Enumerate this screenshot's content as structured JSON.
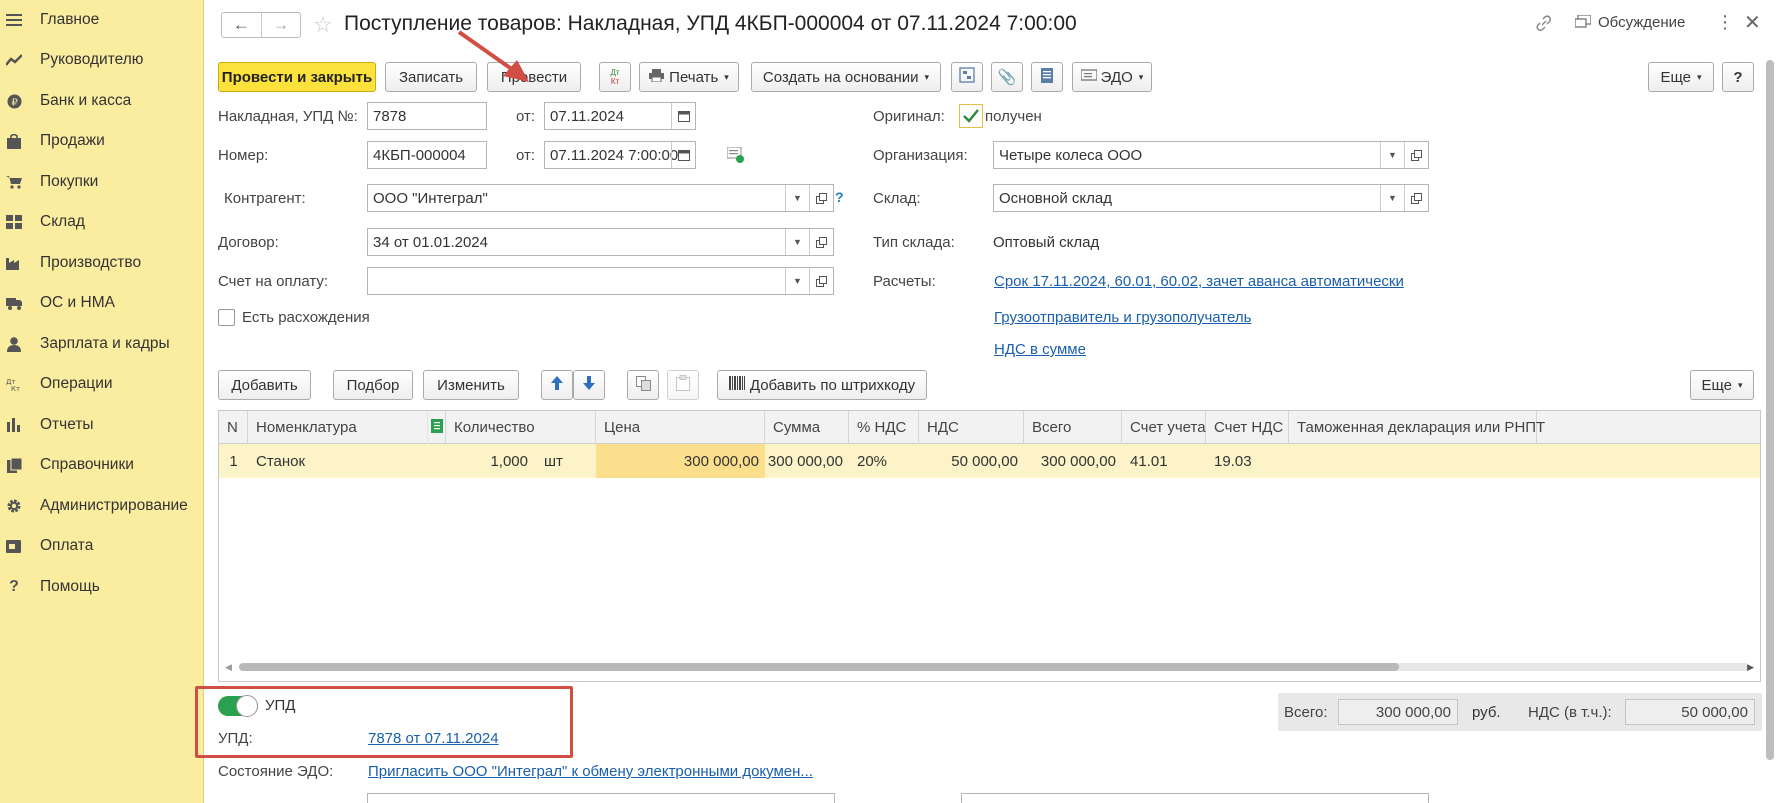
{
  "sidebar": {
    "items": [
      {
        "label": "Главное",
        "icon": "menu-icon"
      },
      {
        "label": "Руководителю",
        "icon": "trend-icon"
      },
      {
        "label": "Банк и касса",
        "icon": "coin-icon"
      },
      {
        "label": "Продажи",
        "icon": "bag-icon"
      },
      {
        "label": "Покупки",
        "icon": "cart-icon"
      },
      {
        "label": "Склад",
        "icon": "warehouse-icon"
      },
      {
        "label": "Производство",
        "icon": "factory-icon"
      },
      {
        "label": "ОС и НМА",
        "icon": "truck-icon"
      },
      {
        "label": "Зарплата и кадры",
        "icon": "person-icon"
      },
      {
        "label": "Операции",
        "icon": "dt-kt-icon"
      },
      {
        "label": "Отчеты",
        "icon": "bar-chart-icon"
      },
      {
        "label": "Справочники",
        "icon": "books-icon"
      },
      {
        "label": "Администрирование",
        "icon": "gear-icon"
      },
      {
        "label": "Оплата",
        "icon": "wallet-icon"
      },
      {
        "label": "Помощь",
        "icon": "help-icon"
      }
    ]
  },
  "header": {
    "title": "Поступление товаров: Накладная, УПД 4КБП-000004 от 07.11.2024 7:00:00",
    "discussion": "Обсуждение"
  },
  "toolbar": {
    "post_close": "Провести и закрыть",
    "save": "Записать",
    "post": "Провести",
    "print": "Печать",
    "create_based": "Создать на основании",
    "edo": "ЭДО",
    "more": "Еще",
    "help": "?",
    "dtkt_top": "Дт",
    "dtkt_bottom": "Кт"
  },
  "form": {
    "invoice_label": "Накладная, УПД №:",
    "invoice_no": "7878",
    "from_label": "от:",
    "invoice_date": "07.11.2024",
    "number_label": "Номер:",
    "number": "4КБП-000004",
    "number_datetime": "07.11.2024  7:00:00",
    "contractor_label": "Контрагент:",
    "contractor": "ООО \"Интеграл\"",
    "contract_label": "Договор:",
    "contract": "34 от 01.01.2024",
    "payment_label": "Счет на оплату:",
    "payment": "",
    "discrepancy_label": "Есть расхождения",
    "original_label": "Оригинал:",
    "original_value": "получен",
    "org_label": "Организация:",
    "org": "Четыре колеса ООО",
    "warehouse_label": "Склад:",
    "warehouse": "Основной склад",
    "wtype_label": "Тип склада:",
    "wtype": "Оптовый склад",
    "calc_label": "Расчеты:",
    "calc_link": "Срок 17.11.2024, 60.01, 60.02, зачет аванса автоматически",
    "shipper_link": "Грузоотправитель и грузополучатель",
    "vat_link": "НДС в сумме",
    "question": "?"
  },
  "table_toolbar": {
    "add": "Добавить",
    "pick": "Подбор",
    "edit": "Изменить",
    "barcode": "Добавить по штрихкоду",
    "more": "Еще"
  },
  "table": {
    "headers": {
      "n": "N",
      "item": "Номенклатура",
      "qty": "Количество",
      "price": "Цена",
      "sum": "Сумма",
      "vat_rate": "% НДС",
      "vat": "НДС",
      "total": "Всего",
      "account": "Счет учета",
      "vat_account": "Счет НДС",
      "customs": "Таможенная декларация или РНПТ"
    },
    "rows": [
      {
        "n": "1",
        "item": "Станок",
        "qty": "1,000",
        "unit": "шт",
        "price": "300 000,00",
        "sum": "300 000,00",
        "vat_rate": "20%",
        "vat": "50 000,00",
        "total": "300 000,00",
        "account": "41.01",
        "vat_account": "19.03",
        "customs": ""
      }
    ]
  },
  "footer": {
    "upd_toggle": "УПД",
    "upd_label": "УПД:",
    "upd_link": "7878 от 07.11.2024",
    "edo_label": "Состояние ЭДО:",
    "edo_link": "Пригласить ООО \"Интеграл\" к обмену электронными докумен...",
    "total_label": "Всего:",
    "total_value": "300 000,00",
    "currency": "руб.",
    "vat_label": "НДС (в т.ч.):",
    "vat_value": "50 000,00"
  }
}
